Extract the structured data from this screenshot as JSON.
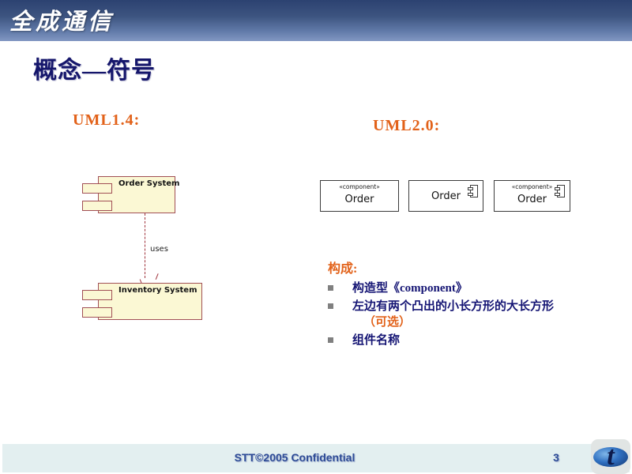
{
  "header": {
    "brand": "全成通信",
    "gradient_top": "#2c4271",
    "gradient_bottom": "#8197c2"
  },
  "title": "概念—符号",
  "title_color": "#15166b",
  "accent_color": "#e2621a",
  "sections": {
    "uml14": {
      "heading": "UML1.4:",
      "components": [
        {
          "name": "Order System"
        },
        {
          "name": "Inventory System"
        }
      ],
      "dependency_label": "uses",
      "component_fill": "#fbf8d4",
      "component_stroke": "#a14f55"
    },
    "uml20": {
      "heading": "UML2.0:",
      "boxes": [
        {
          "stereotype": "«component»",
          "name": "Order",
          "has_icon": false
        },
        {
          "stereotype": "",
          "name": "Order",
          "has_icon": true
        },
        {
          "stereotype": "«component»",
          "name": "Order",
          "has_icon": true
        }
      ]
    }
  },
  "composition": {
    "heading": "构成:",
    "items": [
      {
        "text": "构造型《component》",
        "sub": ""
      },
      {
        "text": "左边有两个凸出的小长方形的大长方形",
        "sub": "（可选）"
      },
      {
        "text": "组件名称",
        "sub": ""
      }
    ],
    "bullet_color": "#808080",
    "text_color": "#151574"
  },
  "footer": {
    "confidential": "STT©2005 Confidential",
    "page_number": "3",
    "bar_color": "#e3eff0",
    "text_color": "#2d4b96"
  }
}
